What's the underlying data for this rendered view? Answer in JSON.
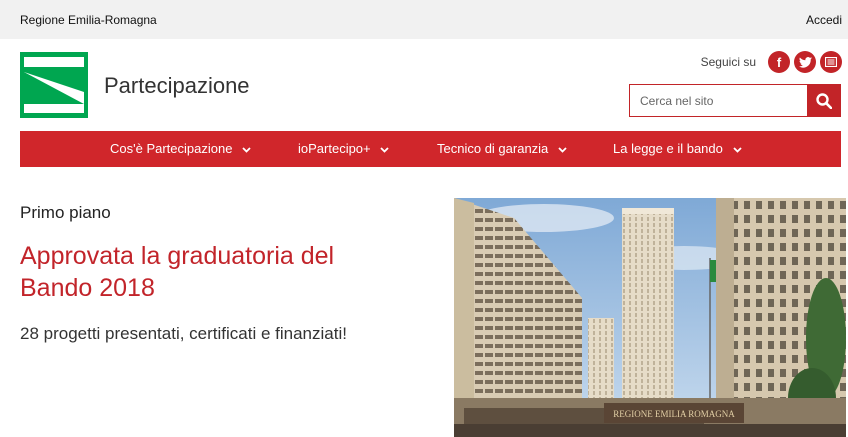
{
  "topbar": {
    "region": "Regione Emilia-Romagna",
    "login": "Accedi"
  },
  "header": {
    "title": "Partecipazione",
    "follow_label": "Seguici su",
    "social": [
      {
        "icon": "facebook-icon",
        "glyph": "f"
      },
      {
        "icon": "twitter-icon",
        "glyph": ""
      },
      {
        "icon": "newsletter-icon",
        "glyph": ""
      }
    ],
    "search_placeholder": "Cerca nel sito"
  },
  "nav": {
    "items": [
      {
        "label": "Cos'è Partecipazione"
      },
      {
        "label": "ioPartecipo+"
      },
      {
        "label": "Tecnico di garanzia"
      },
      {
        "label": "La legge e il bando"
      }
    ]
  },
  "main": {
    "kicker": "Primo piano",
    "headline": "Approvata la graduatoria del Bando 2018",
    "subtitle": "28 progetti presentati, certificati e finanziati!",
    "photo_sign": "REGIONE EMILIA ROMAGNA"
  },
  "colors": {
    "brand_red": "#c22428",
    "nav_red": "#d0262b",
    "logo_green": "#00a650"
  }
}
